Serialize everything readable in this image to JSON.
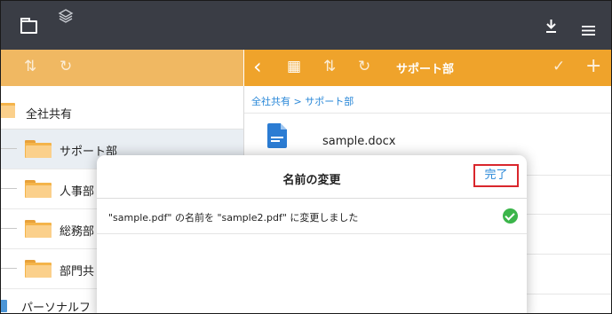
{
  "topbar": {
    "icons": [
      "folder-icon",
      "layers-icon",
      "download-icon",
      "menu-icon"
    ]
  },
  "left_toolbar": {
    "sort_glyph": "⇅",
    "refresh_glyph": "↻"
  },
  "right_toolbar": {
    "back_glyph": "‹",
    "grid_glyph": "▦",
    "sort_glyph": "⇅",
    "refresh_glyph": "↻",
    "title": "サポート部",
    "check_glyph": "✓",
    "add_glyph": "+"
  },
  "tree": {
    "root_label": "全社共有",
    "items": [
      {
        "label": "サポート部",
        "selected": true
      },
      {
        "label": "人事部",
        "selected": false
      },
      {
        "label": "総務部",
        "selected": false
      },
      {
        "label": "部門共",
        "selected": false
      }
    ],
    "personal_label": "パーソナルフ"
  },
  "main": {
    "breadcrumb": "全社共有 > サポート部",
    "files": [
      {
        "name": "sample.docx",
        "icon": "word-doc-icon"
      }
    ]
  },
  "dialog": {
    "title": "名前の変更",
    "done_label": "完了",
    "message": "\"sample.pdf\" の名前を \"sample2.pdf\" に変更しました",
    "status_icon": "success-check-icon"
  },
  "colors": {
    "topbar": "#3a3d45",
    "toolbar_orange": "#efa32b",
    "toolbar_orange_light": "#f0b862",
    "link_blue": "#2a88d8",
    "highlight_red": "#d9262c",
    "success_green": "#3bb54a"
  }
}
